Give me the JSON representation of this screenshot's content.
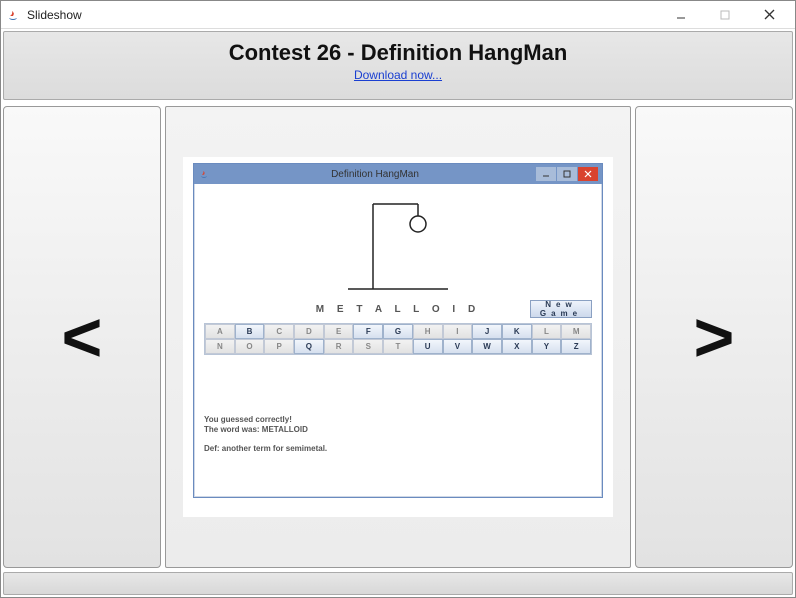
{
  "outer": {
    "title": "Slideshow"
  },
  "header": {
    "title": "Contest 26 - Definition HangMan",
    "link": "Download now..."
  },
  "nav": {
    "prev": "<",
    "next": ">"
  },
  "inner": {
    "title": "Definition HangMan",
    "word": "M E T A L L O I D",
    "newgame": "New Game",
    "letters": [
      "A",
      "B",
      "C",
      "D",
      "E",
      "F",
      "G",
      "H",
      "I",
      "J",
      "K",
      "L",
      "M",
      "N",
      "O",
      "P",
      "Q",
      "R",
      "S",
      "T",
      "U",
      "V",
      "W",
      "X",
      "Y",
      "Z"
    ],
    "active_letters": [
      "B",
      "F",
      "G",
      "J",
      "K",
      "Q",
      "U",
      "V",
      "W",
      "X",
      "Y",
      "Z"
    ],
    "result_line1": "You guessed correctly!",
    "result_line2": "The word was: METALLOID",
    "result_line3": "Def: another term for semimetal."
  }
}
